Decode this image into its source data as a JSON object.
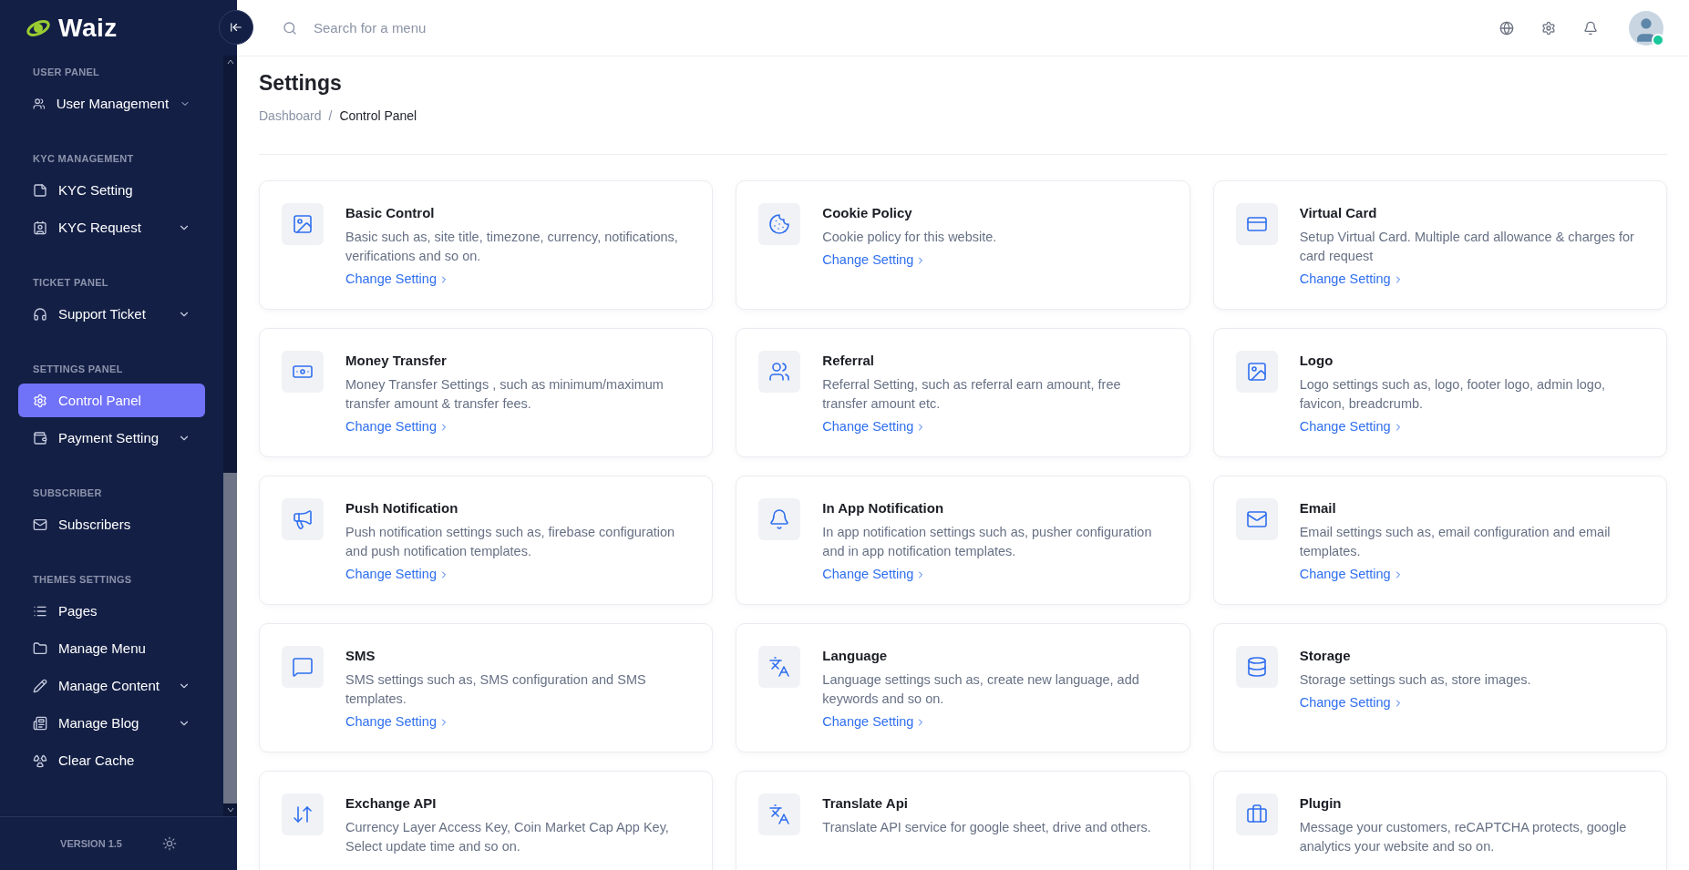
{
  "sidebar": {
    "logo": "Waiz",
    "sections": [
      {
        "title": "USER PANEL",
        "items": [
          {
            "label": "User Management",
            "expandable": true,
            "selected": false
          }
        ]
      },
      {
        "title": "KYC MANAGEMENT",
        "items": [
          {
            "label": "KYC Setting",
            "expandable": false,
            "selected": false
          },
          {
            "label": "KYC Request",
            "expandable": true,
            "selected": false
          }
        ]
      },
      {
        "title": "TICKET PANEL",
        "items": [
          {
            "label": "Support Ticket",
            "expandable": true,
            "selected": false
          }
        ]
      },
      {
        "title": "SETTINGS PANEL",
        "items": [
          {
            "label": "Control Panel",
            "expandable": false,
            "selected": true
          },
          {
            "label": "Payment Setting",
            "expandable": true,
            "selected": false
          }
        ]
      },
      {
        "title": "SUBSCRIBER",
        "items": [
          {
            "label": "Subscribers",
            "expandable": false,
            "selected": false
          }
        ]
      },
      {
        "title": "THEMES SETTINGS",
        "items": [
          {
            "label": "Pages",
            "expandable": false,
            "selected": false
          },
          {
            "label": "Manage Menu",
            "expandable": false,
            "selected": false
          },
          {
            "label": "Manage Content",
            "expandable": true,
            "selected": false
          },
          {
            "label": "Manage Blog",
            "expandable": true,
            "selected": false
          },
          {
            "label": "Clear Cache",
            "expandable": false,
            "selected": false
          }
        ]
      }
    ],
    "version": "VERSION 1.5"
  },
  "header": {
    "search": {
      "placeholder": "Search for a menu"
    },
    "user": {
      "online": true
    }
  },
  "page": {
    "title": "Settings",
    "separator": "/",
    "breadcrumb": [
      {
        "label": "Dashboard",
        "selected": false
      },
      {
        "label": "Control Panel",
        "selected": true
      }
    ]
  },
  "cards": [
    {
      "title": "Basic Control",
      "description": "Basic such as, site title, timezone, currency, notifications, verifications and so on.",
      "link": "Change Setting"
    },
    {
      "title": "Cookie Policy",
      "description": "Cookie policy for this website.",
      "link": "Change Setting"
    },
    {
      "title": "Virtual Card",
      "description": "Setup Virtual Card. Multiple card allowance & charges for card request",
      "link": "Change Setting"
    },
    {
      "title": "Money Transfer",
      "description": "Money Transfer Settings , such as minimum/maximum transfer amount & transfer fees.",
      "link": "Change Setting"
    },
    {
      "title": "Referral",
      "description": "Referral Setting, such as referral earn amount, free transfer amount etc.",
      "link": "Change Setting"
    },
    {
      "title": "Logo",
      "description": "Logo settings such as, logo, footer logo, admin logo, favicon, breadcrumb.",
      "link": "Change Setting"
    },
    {
      "title": "Push Notification",
      "description": "Push notification settings such as, firebase configuration and push notification templates.",
      "link": "Change Setting"
    },
    {
      "title": "In App Notification",
      "description": "In app notification settings such as, pusher configuration and in app notification templates.",
      "link": "Change Setting"
    },
    {
      "title": "Email",
      "description": "Email settings such as, email configuration and email templates.",
      "link": "Change Setting"
    },
    {
      "title": "SMS",
      "description": "SMS settings such as, SMS configuration and SMS templates.",
      "link": "Change Setting"
    },
    {
      "title": "Language",
      "description": "Language settings such as, create new language, add keywords and so on.",
      "link": "Change Setting"
    },
    {
      "title": "Storage",
      "description": "Storage settings such as, store images.",
      "link": "Change Setting"
    },
    {
      "title": "Exchange API",
      "description": "Currency Layer Access Key, Coin Market Cap App Key, Select update time and so on."
    },
    {
      "title": "Translate Api",
      "description": "Translate API service for google sheet, drive and others."
    },
    {
      "title": "Plugin",
      "description": "Message your customers, reCAPTCHA protects, google analytics your website and so on."
    }
  ]
}
